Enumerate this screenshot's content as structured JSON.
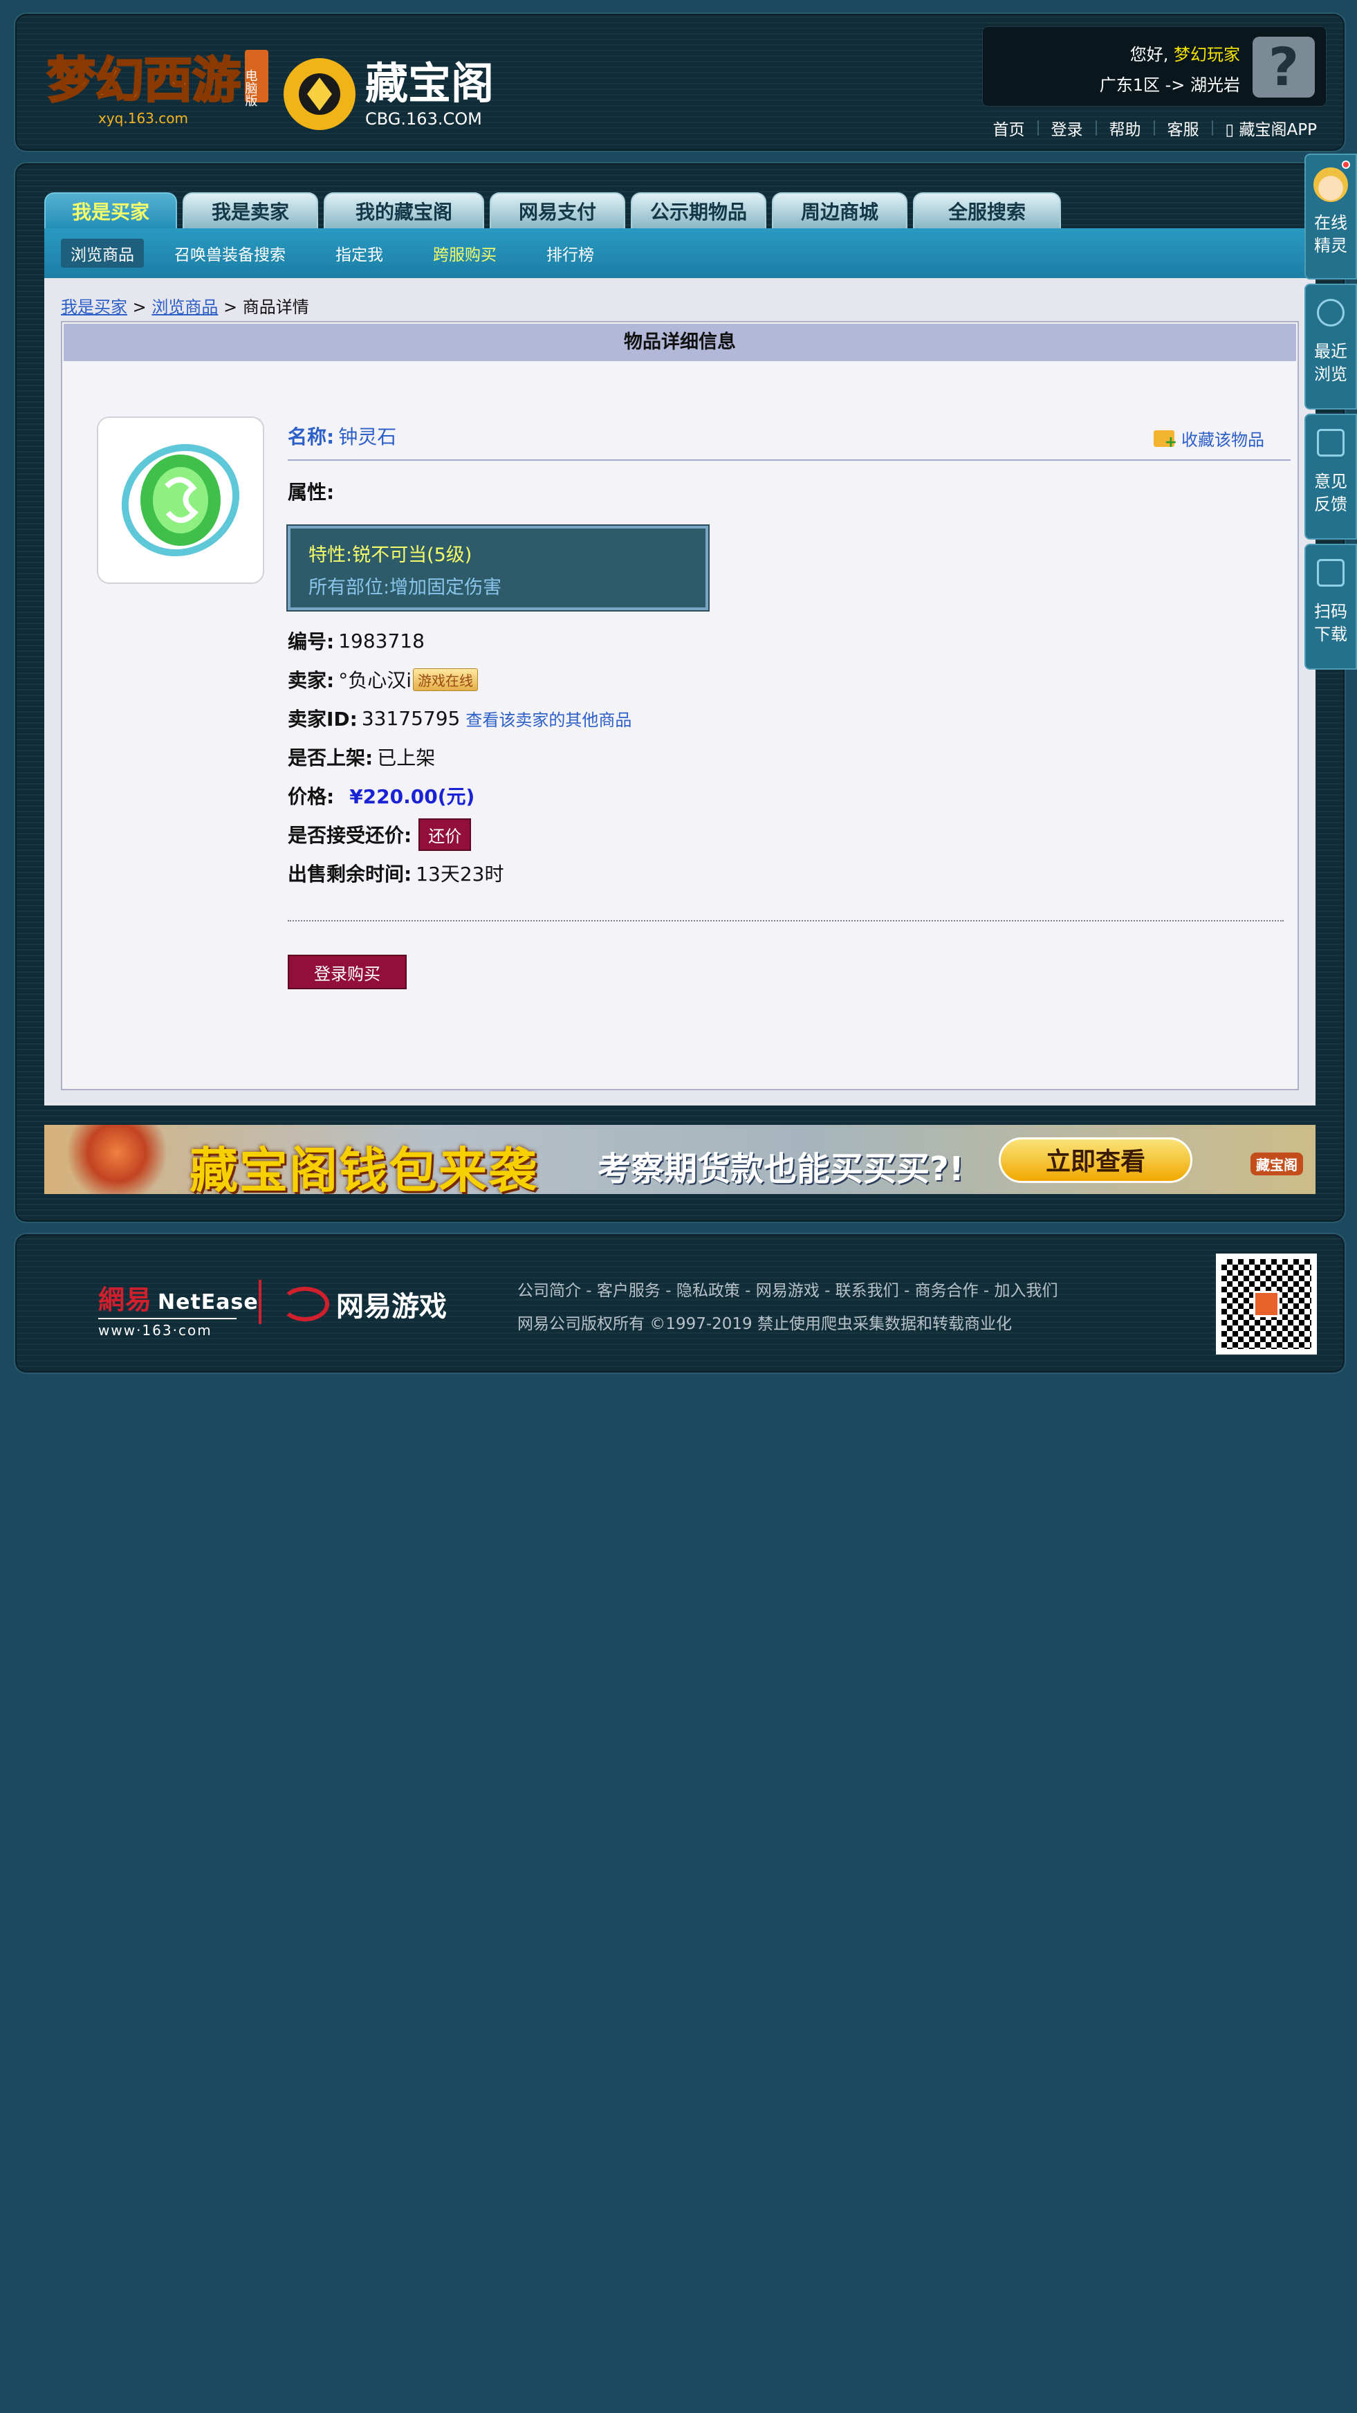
{
  "header": {
    "logo_game_text": "梦幻西游",
    "logo_game_badge": "电脑版",
    "logo_game_url": "xyq.163.com",
    "logo_cbg_text": "藏宝阁",
    "logo_cbg_url": "CBG.163.COM",
    "greeting": "您好,",
    "username": "梦幻玩家",
    "server": "广东1区 -> 湖光岩",
    "avatar_icon": "question-mark-icon",
    "nav": [
      "首页",
      "登录",
      "帮助",
      "客服",
      "藏宝阁APP"
    ]
  },
  "tabs": [
    "我是买家",
    "我是卖家",
    "我的藏宝阁",
    "网易支付",
    "公示期物品",
    "周边商城",
    "全服搜索"
  ],
  "subnav": [
    "浏览商品",
    "召唤兽装备搜索",
    "指定我",
    "跨服购买",
    "排行榜"
  ],
  "breadcrumb": {
    "a": "我是买家",
    "sep1": ">",
    "b": "浏览商品",
    "sep2": ">",
    "c": "商品详情"
  },
  "panel": {
    "title": "物品详细信息",
    "name_label": "名称:",
    "name_value": "钟灵石",
    "favorite": "收藏该物品",
    "attr_label": "属性:",
    "attr_line1": "特性:锐不可当(5级)",
    "attr_line2": "所有部位:增加固定伤害",
    "id_label": "编号:",
    "id_value": "1983718",
    "seller_label": "卖家:",
    "seller_value": "°负心汉i",
    "seller_status": "游戏在线",
    "seller_id_label": "卖家ID:",
    "seller_id_value": "33175795",
    "seller_other_link": "查看该卖家的其他商品",
    "listed_label": "是否上架:",
    "listed_value": "已上架",
    "price_label": "价格:",
    "price_value": "¥220.00(元)",
    "bargain_label": "是否接受还价:",
    "bargain_button": "还价",
    "remaining_label": "出售剩余时间:",
    "remaining_value": "13天23时",
    "buy_button": "登录购买"
  },
  "banner": {
    "title": "藏宝阁钱包来袭",
    "subtitle": "考察期货款也能买买买?!",
    "button": "立即查看",
    "logo": "藏宝阁"
  },
  "footer": {
    "netease_cn": "網易",
    "netease_en": "NetEase",
    "netease_url": "www·163·com",
    "netease_games": "网易游戏",
    "links": "公司简介 - 客户服务 - 隐私政策 - 网易游戏 - 联系我们 - 商务合作 - 加入我们",
    "copyright": "网易公司版权所有 ©1997-2019 禁止使用爬虫采集数据和转载商业化"
  },
  "sidebar": [
    {
      "label": "在线精灵",
      "icon": "sprite-avatar-icon"
    },
    {
      "label": "最近浏览",
      "icon": "clock-icon"
    },
    {
      "label": "意见反馈",
      "icon": "edit-icon"
    },
    {
      "label": "扫码下载",
      "icon": "scan-icon"
    }
  ],
  "colors": {
    "page_bg": "#1b4a5e",
    "tab_active": "#248fb6",
    "accent_red": "#930f3b",
    "link_blue": "#2d5fc8",
    "highlight_yellow": "#f6ff6a"
  }
}
